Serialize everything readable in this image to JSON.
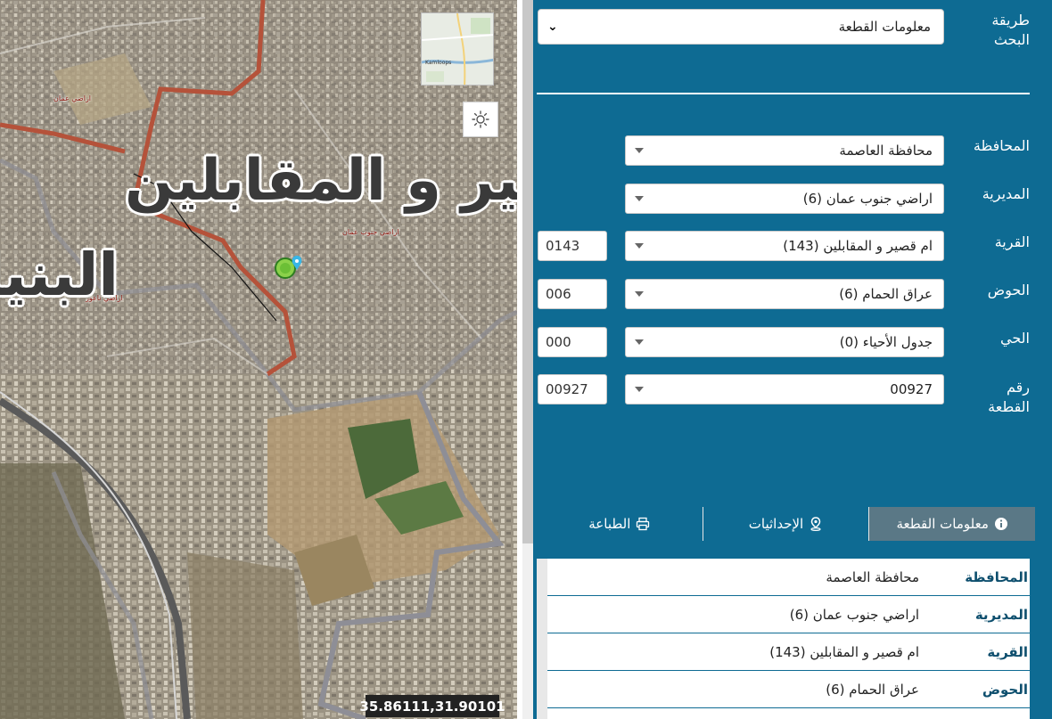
{
  "map": {
    "labels_big": [
      "مير و المقابلين",
      "البنيا"
    ],
    "labels_small": [
      "اراضي عمان",
      "اراضي جنوب عمان",
      "اراضي ناعور"
    ],
    "minimap_label": "Kamloops",
    "coords": "35.86111,31.90101",
    "icons": {
      "theme": "sun-icon",
      "pin": "location-pin-icon"
    }
  },
  "search": {
    "label": "طريقة البحث",
    "value": "معلومات القطعة"
  },
  "form": {
    "governorate": {
      "label": "المحافظة",
      "value": "محافظة العاصمة"
    },
    "directorate": {
      "label": "المديرية",
      "value": "اراضي جنوب عمان (6)"
    },
    "village": {
      "label": "القرية",
      "value": "ام قصير و المقابلين (143)",
      "code": "0143"
    },
    "basin": {
      "label": "الحوض",
      "value": "عراق الحمام (6)",
      "code": "006"
    },
    "district": {
      "label": "الحي",
      "value": "جدول الأحياء (0)",
      "code": "000"
    },
    "parcel": {
      "label": "رقم القطعة",
      "value": "00927",
      "code": "00927"
    }
  },
  "tabs": [
    {
      "label": "معلومات القطعة",
      "icon": "info-icon",
      "active": true
    },
    {
      "label": "الإحداثيات",
      "icon": "location-icon",
      "active": false
    },
    {
      "label": "الطباعة",
      "icon": "printer-icon",
      "active": false
    }
  ],
  "info": [
    {
      "key": "المحافظة",
      "value": "محافظة العاصمة"
    },
    {
      "key": "المديرية",
      "value": "اراضي جنوب عمان (6)"
    },
    {
      "key": "القرية",
      "value": "ام قصير و المقابلين (143)"
    },
    {
      "key": "الحوض",
      "value": "عراق الحمام (6)"
    }
  ],
  "colors": {
    "panel": "#0e6b93",
    "active_tab": "#5a7886",
    "boundary": "#b5523a"
  }
}
